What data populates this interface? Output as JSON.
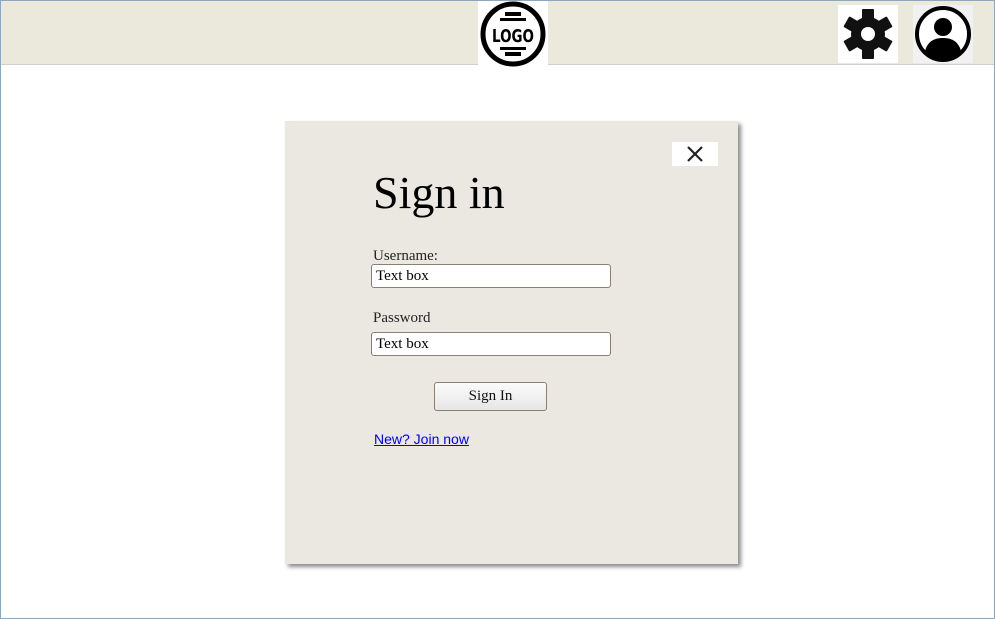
{
  "header": {
    "logo_text": "LOGO",
    "settings_icon": "gear-icon",
    "profile_icon": "user-avatar-icon"
  },
  "dialog": {
    "close_icon": "close-icon",
    "title": "Sign in",
    "username_label": "Username:",
    "username_value": "Text box",
    "password_label": "Password",
    "password_value": "Text box",
    "submit_label": "Sign In",
    "join_link": "New? Join now"
  }
}
